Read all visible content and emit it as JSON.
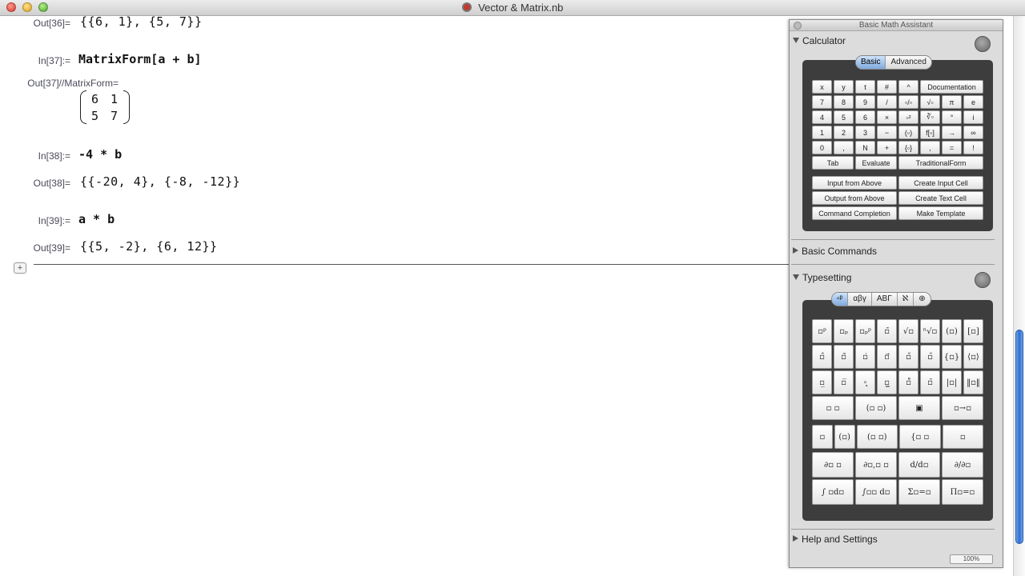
{
  "window": {
    "title": "Vector & Matrix.nb"
  },
  "notebook": {
    "cells": [
      {
        "label": "Out[36]=",
        "content": "{{6, 1}, {5, 7}}"
      },
      {
        "label": "In[37]:=",
        "content": "MatrixForm[a + b]"
      },
      {
        "label": "Out[37]//MatrixForm=",
        "matrix": [
          "6",
          "1",
          "5",
          "7"
        ]
      },
      {
        "label": "In[38]:=",
        "content": "-4 * b"
      },
      {
        "label": "Out[38]=",
        "content": "{{-20, 4}, {-8, -12}}"
      },
      {
        "label": "In[39]:=",
        "content": "a * b"
      },
      {
        "label": "Out[39]=",
        "content": "{{5, -2}, {6, 12}}"
      }
    ],
    "insert_button": "+"
  },
  "palette": {
    "title": "Basic Math Assistant",
    "calculator": {
      "header": "Calculator",
      "tabs": [
        "Basic",
        "Advanced"
      ],
      "active_tab": "Basic",
      "keys": [
        "x",
        "y",
        "t",
        "#",
        "^",
        "Documentation",
        "7",
        "8",
        "9",
        "/",
        "▫/▫",
        "√▫",
        "π",
        "e",
        "4",
        "5",
        "6",
        "×",
        "▫²",
        "∛▫",
        "°",
        "i",
        "1",
        "2",
        "3",
        "−",
        "(▫)",
        "f[▫]",
        "→",
        "∞",
        "0",
        ",",
        "N",
        "+",
        "{▫}",
        ",",
        "=",
        "!",
        "Tab",
        "Evaluate",
        "TraditionalForm",
        "Input from Above",
        "Create Input Cell",
        "Output from Above",
        "Create Text Cell",
        "Command Completion",
        "Make Template"
      ]
    },
    "basic_commands": {
      "header": "Basic Commands"
    },
    "typesetting": {
      "header": "Typesetting",
      "tabs": [
        "▫ᵖ",
        "αβγ",
        "ΑΒΓ",
        "ℵ",
        "⊕"
      ],
      "row1": [
        "▫ᵖ",
        "▫ₚ",
        "▫ₚᵖ",
        "▫̄",
        "√▫",
        "ⁿ√▫",
        "(▫)",
        "[▫]"
      ],
      "row2": [
        "▫̂",
        "▫̃",
        "▫̇",
        "▫⃗",
        "▫̌",
        "▫̆",
        "{▫}",
        "⟨▫⟩"
      ],
      "row3": [
        "▫̲",
        "▫̅",
        "▫͓",
        "▫̳",
        "▫̊",
        "▫̑",
        "|▫|",
        "‖▫‖"
      ],
      "row4": [
        "▫ ▫",
        "(▫ ▫)",
        "▣",
        "▫→▫"
      ],
      "row5": [
        "▫",
        "(▫)",
        "(▫ ▫)",
        "{▫ ▫",
        "▫"
      ],
      "row6": [
        "∂▫ ▫",
        "∂▫,▫ ▫",
        "d/d▫",
        "∂/∂▫"
      ],
      "row7": [
        "∫ ▫d▫",
        "∫▫▫ d▫",
        "Σ▫=▫",
        "Π▫=▫"
      ]
    },
    "help": {
      "header": "Help and Settings"
    },
    "zoom": "100%"
  }
}
